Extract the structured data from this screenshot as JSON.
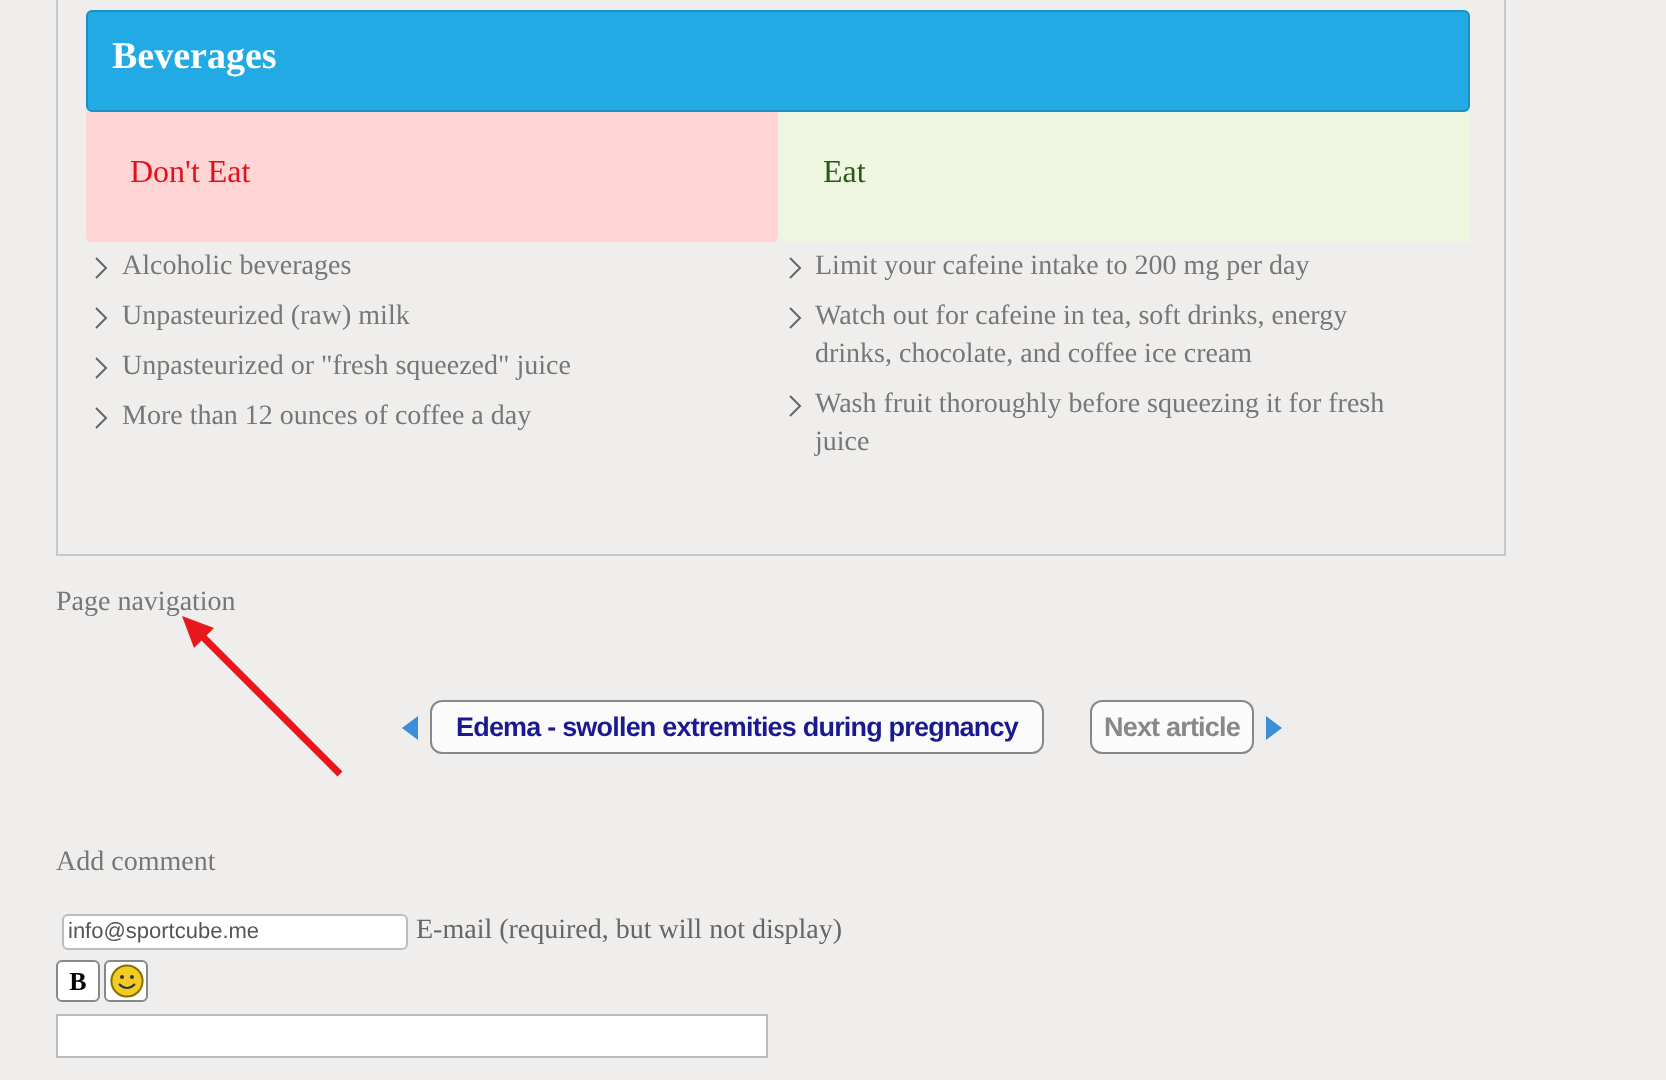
{
  "section": {
    "title": "Beverages",
    "columns": [
      {
        "kind": "avoid",
        "heading": "Don't Eat",
        "items": [
          "Alcoholic beverages",
          "Unpasteurized (raw) milk",
          "Unpasteurized or \"fresh squeezed\" juice",
          "More than 12 ounces of coffee a day"
        ]
      },
      {
        "kind": "allow",
        "heading": "Eat",
        "items": [
          "Limit your cafeine intake to 200 mg per day",
          "Watch out for cafeine in tea, soft drinks, energy drinks, chocolate, and coffee ice cream",
          "Wash fruit thoroughly before squeezing it for fresh juice"
        ]
      }
    ]
  },
  "page_navigation": {
    "label": "Page navigation",
    "previous": "Edema - swollen extremities during pregnancy",
    "next": "Next article"
  },
  "comment_form": {
    "heading": "Add comment",
    "email": {
      "value": "info@sportcube.me",
      "label": "E-mail (required, but will not display)"
    },
    "bold_button": "B"
  }
}
